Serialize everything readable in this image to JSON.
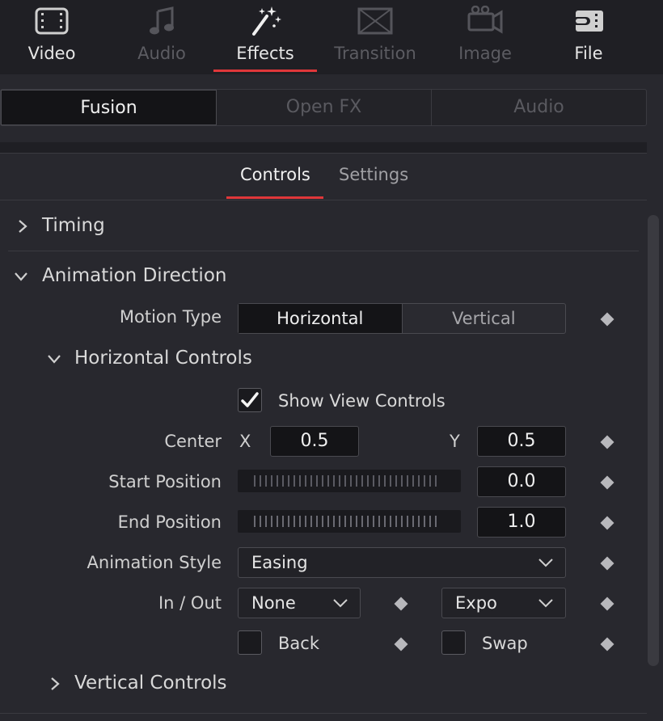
{
  "top_tabs": [
    {
      "label": "Video",
      "icon": "film-icon",
      "state": "normal"
    },
    {
      "label": "Audio",
      "icon": "music-note-icon",
      "state": "disabled"
    },
    {
      "label": "Effects",
      "icon": "magic-wand-icon",
      "state": "active"
    },
    {
      "label": "Transition",
      "icon": "transition-icon",
      "state": "disabled"
    },
    {
      "label": "Image",
      "icon": "camera-icon",
      "state": "disabled"
    },
    {
      "label": "File",
      "icon": "file-tag-icon",
      "state": "normal"
    }
  ],
  "segments": [
    {
      "label": "Fusion",
      "state": "active"
    },
    {
      "label": "Open FX",
      "state": "inactive"
    },
    {
      "label": "Audio",
      "state": "inactive"
    }
  ],
  "sub_tabs": {
    "controls": "Controls",
    "settings": "Settings"
  },
  "sections": {
    "timing": "Timing",
    "animation_direction": "Animation Direction",
    "horizontal_controls": "Horizontal Controls",
    "vertical_controls": "Vertical Controls"
  },
  "motion_type": {
    "label": "Motion Type",
    "options": [
      "Horizontal",
      "Vertical"
    ],
    "selected": "Horizontal"
  },
  "show_view_controls": {
    "label": "Show View Controls",
    "checked": true
  },
  "center": {
    "label": "Center",
    "x_label": "X",
    "x": "0.5",
    "y_label": "Y",
    "y": "0.5"
  },
  "start_position": {
    "label": "Start Position",
    "value": "0.0"
  },
  "end_position": {
    "label": "End Position",
    "value": "1.0"
  },
  "animation_style": {
    "label": "Animation Style",
    "value": "Easing"
  },
  "in_out": {
    "label": "In / Out",
    "in_value": "None",
    "out_value": "Expo"
  },
  "back": {
    "label": "Back",
    "checked": false
  },
  "swap": {
    "label": "Swap",
    "checked": false
  },
  "colors": {
    "accent": "#e0373a",
    "panel": "#28282e",
    "field": "#141417"
  }
}
